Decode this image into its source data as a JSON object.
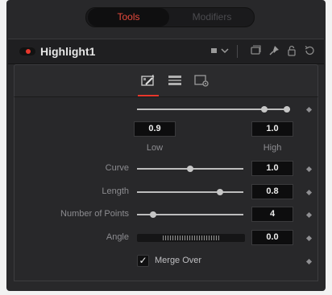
{
  "tabs": {
    "tools": "Tools",
    "modifiers": "Modifiers"
  },
  "tool": {
    "name": "Highlight1"
  },
  "icons": {
    "header": [
      "color-swatch-icon",
      "chevron-down-icon",
      "window-icon",
      "pin-icon",
      "lock-icon",
      "reset-icon"
    ],
    "section_tabs": [
      "controls-tab-icon",
      "gradient-tab-icon",
      "settings-tab-icon"
    ]
  },
  "threshold": {
    "low_value": "0.9",
    "high_value": "1.0",
    "low_label": "Low",
    "high_label": "High"
  },
  "params": {
    "curve": {
      "label": "Curve",
      "value": "1.0",
      "slider_fraction": 0.5
    },
    "length": {
      "label": "Length",
      "value": "0.8",
      "slider_fraction": 0.8
    },
    "points": {
      "label": "Number of Points",
      "value": "4",
      "slider_fraction": 0.15
    },
    "angle": {
      "label": "Angle",
      "value": "0.0"
    }
  },
  "merge_over": {
    "label": "Merge Over",
    "checked": true,
    "check_glyph": "✓"
  },
  "colors": {
    "accent_red": "#e8372c",
    "panel_bg": "#28282a"
  }
}
